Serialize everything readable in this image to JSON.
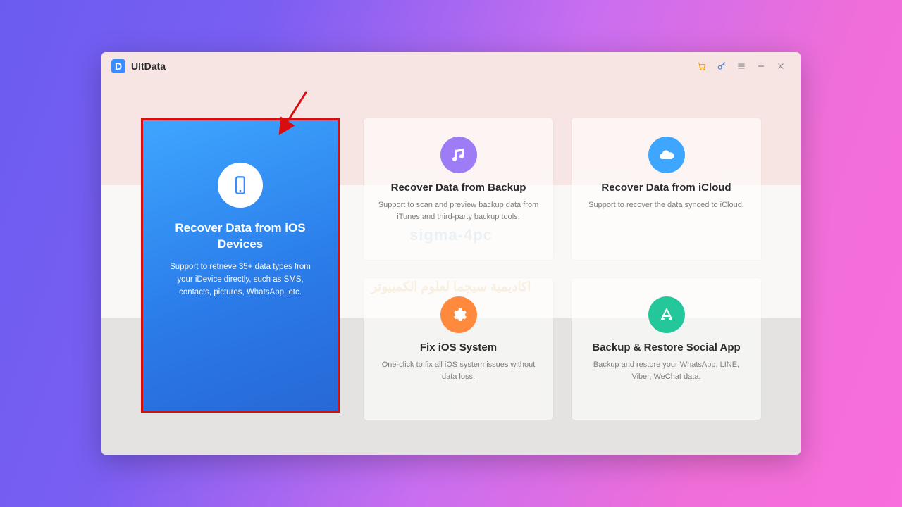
{
  "app": {
    "logo_letter": "D",
    "title": "UltData"
  },
  "titlebar_icons": {
    "cart": "cart-icon",
    "key": "key-icon",
    "menu": "menu-icon",
    "minimize": "minimize-icon",
    "close": "close-icon"
  },
  "main_card": {
    "title": "Recover Data from iOS Devices",
    "desc": "Support to retrieve 35+ data types from your iDevice directly, such as SMS, contacts, pictures, WhatsApp, etc."
  },
  "cards": [
    {
      "title": "Recover Data from Backup",
      "desc": "Support to scan and preview backup data from iTunes and third-party backup tools.",
      "color": "c-purple",
      "icon": "music-icon",
      "name": "card-recover-backup"
    },
    {
      "title": "Recover Data from iCloud",
      "desc": "Support to recover the data synced to iCloud.",
      "color": "c-blue",
      "icon": "cloud-icon",
      "name": "card-recover-icloud"
    },
    {
      "title": "Fix iOS System",
      "desc": "One-click to fix all iOS system issues without data loss.",
      "color": "c-orange",
      "icon": "gear-icon",
      "name": "card-fix-ios"
    },
    {
      "title": "Backup & Restore Social App",
      "desc": "Backup and restore your WhatsApp, LINE, Viber, WeChat data.",
      "color": "c-teal",
      "icon": "appstore-icon",
      "name": "card-backup-social"
    }
  ],
  "watermark": {
    "line1": "sigma-4pc",
    "line2": "اكاديمية سيجما لعلوم الكمبيوتر"
  },
  "colors": {
    "highlight_border": "#d90d0d",
    "accent_blue": "#3a8cff"
  }
}
